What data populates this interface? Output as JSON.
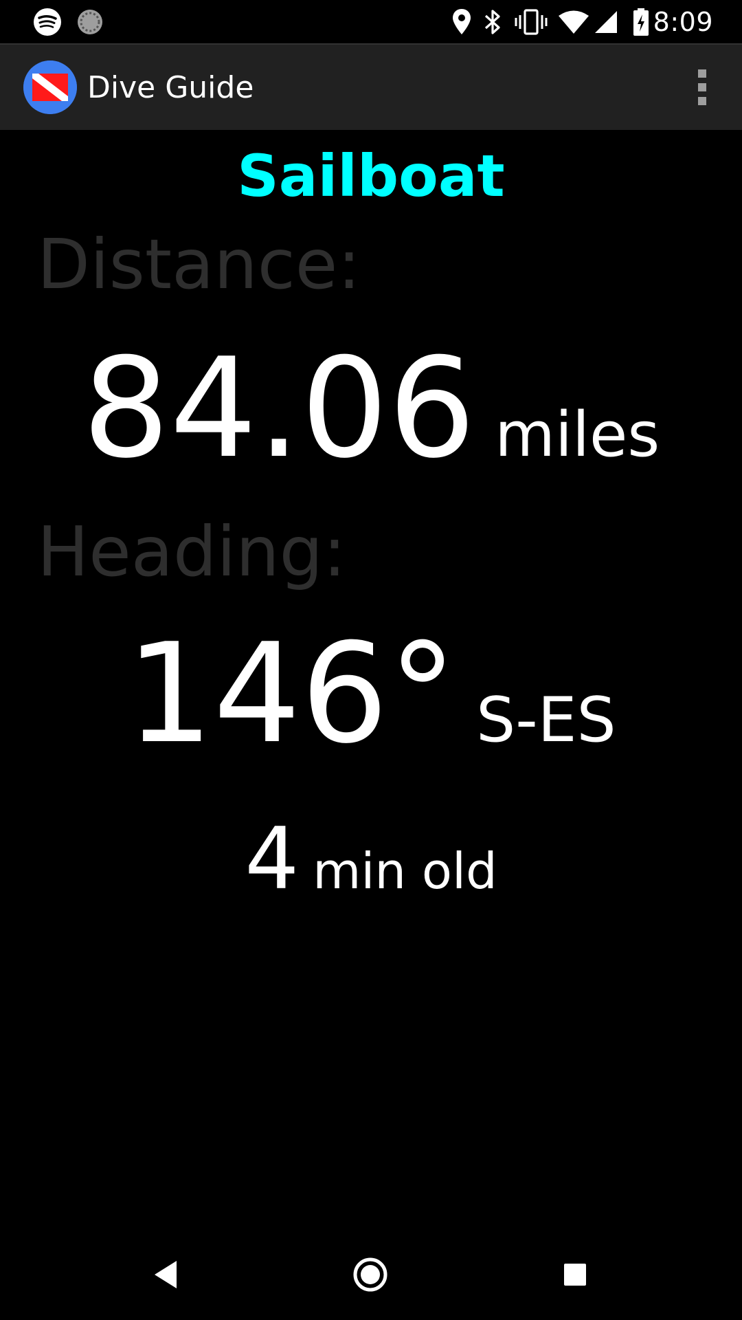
{
  "status_bar": {
    "time": "8:09",
    "left_icons": [
      "spotify-icon",
      "sync-icon"
    ],
    "right_icons": [
      "location-icon",
      "bluetooth-icon",
      "vibrate-icon",
      "wifi-icon",
      "cell-signal-icon",
      "battery-charging-icon"
    ]
  },
  "app_bar": {
    "title": "Dive Guide",
    "logo_icon": "dive-flag-icon",
    "menu_icon": "overflow-menu-icon"
  },
  "target": {
    "name": "Sailboat"
  },
  "distance": {
    "label": "Distance:",
    "value": "84.06",
    "unit": "miles"
  },
  "heading": {
    "label": "Heading:",
    "value": "146°",
    "direction": "S-ES"
  },
  "age": {
    "value": "4",
    "unit": "min old"
  },
  "colors": {
    "accent": "#00ffff",
    "label": "#2e2e2e",
    "value": "#ffffff",
    "app_bar": "#212121",
    "background": "#000000"
  },
  "nav_bar": {
    "icons": [
      "back-icon",
      "home-icon",
      "recents-icon"
    ]
  }
}
